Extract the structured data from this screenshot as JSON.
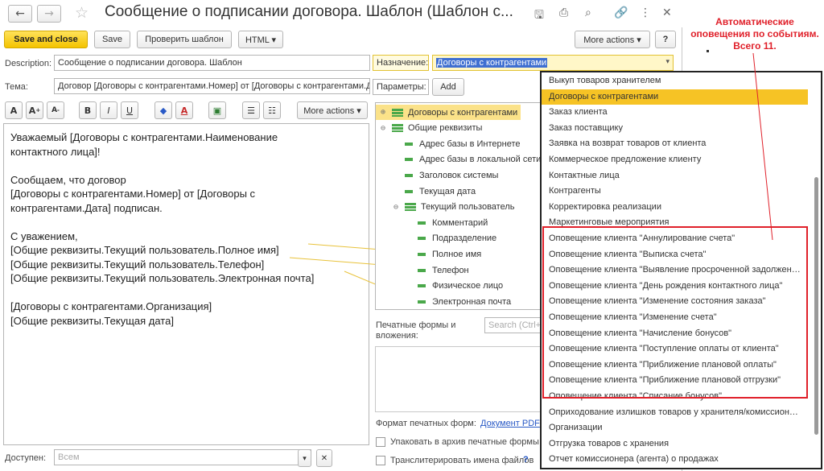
{
  "window": {
    "title": "Сообщение о подписании договора. Шаблон (Шаблон с...",
    "nav_back": "←",
    "nav_forward": "→",
    "favorite_icon": "star-icon",
    "title_icons": [
      "save-icon",
      "print-icon",
      "preview-icon",
      "link-icon",
      "more-icon",
      "close-icon"
    ]
  },
  "toolbar": {
    "save_and_close": "Save and close",
    "save": "Save",
    "check_template": "Проверить шаблон",
    "html": "HTML ▾",
    "more_actions": "More actions ▾",
    "help": "?"
  },
  "form": {
    "description_label": "Description:",
    "description_value": "Сообщение о подписании договора. Шаблон",
    "subject_label": "Тема:",
    "subject_value": "Договор [Договоры с контрагентами.Номер] от [Договоры с контрагентами.Д",
    "purpose_label": "Назначение:",
    "purpose_value": "Договоры с контрагентами",
    "params_label": "Параметры:",
    "add_button": "Add",
    "available_label": "Доступен:",
    "available_placeholder": "Всем"
  },
  "format_toolbar": {
    "buttons": [
      "A",
      "A⁺",
      "A⁻",
      "B",
      "I",
      "U",
      "◆",
      "A",
      "▣",
      "☰",
      "☷"
    ],
    "more_actions": "More actions ▾"
  },
  "editor": {
    "text": "Уважаемый [Договоры с контрагентами.Наименование\nконтактного лица]!\n\nСообщаем, что договор\n[Договоры с контрагентами.Номер] от [Договоры с\nконтрагентами.Дата] подписан.\n\nС уважением,\n[Общие реквизиты.Текущий пользователь.Полное имя]\n[Общие реквизиты.Текущий пользователь.Телефон]\n[Общие реквизиты.Текущий пользователь.Электронная почта]\n\n[Договоры с контрагентами.Организация]\n[Общие реквизиты.Текущая дата]"
  },
  "tree": {
    "items": [
      {
        "label": "Договоры с контрагентами",
        "level": 0,
        "kind": "collapsed",
        "selected": true
      },
      {
        "label": "Общие реквизиты",
        "level": 0,
        "kind": "expanded",
        "selected": false
      },
      {
        "label": "Адрес базы в Интернете",
        "level": 1,
        "kind": "leaf",
        "selected": false
      },
      {
        "label": "Адрес базы в локальной сети",
        "level": 1,
        "kind": "leaf",
        "selected": false
      },
      {
        "label": "Заголовок системы",
        "level": 1,
        "kind": "leaf",
        "selected": false
      },
      {
        "label": "Текущая дата",
        "level": 1,
        "kind": "leaf",
        "selected": false
      },
      {
        "label": "Текущий пользователь",
        "level": 1,
        "kind": "expanded",
        "selected": false
      },
      {
        "label": "Комментарий",
        "level": 2,
        "kind": "leaf",
        "selected": false
      },
      {
        "label": "Подразделение",
        "level": 2,
        "kind": "leaf",
        "selected": false
      },
      {
        "label": "Полное имя",
        "level": 2,
        "kind": "leaf",
        "selected": false
      },
      {
        "label": "Телефон",
        "level": 2,
        "kind": "leaf",
        "selected": false
      },
      {
        "label": "Физическое лицо",
        "level": 2,
        "kind": "leaf",
        "selected": false
      },
      {
        "label": "Электронная почта",
        "level": 2,
        "kind": "leaf",
        "selected": false
      }
    ]
  },
  "attachments": {
    "label_line1": "Печатные формы и",
    "label_line2": "вложения:",
    "search_placeholder": "Search (Ctrl+F)",
    "format_label": "Формат печатных форм:",
    "format_link": "Документ PDF",
    "zip_checkbox": "Упаковать в архив печатные формы",
    "translit_checkbox": "Транслитерировать имена файлов",
    "help": "?"
  },
  "dropdown": {
    "items": [
      "Выкуп товаров хранителем",
      "Договоры с контрагентами",
      "Заказ клиента",
      "Заказ поставщику",
      "Заявка на возврат товаров от клиента",
      "Коммерческое предложение клиенту",
      "Контактные лица",
      "Контрагенты",
      "Корректировка реализации",
      "Маркетинговые мероприятия",
      "Оповещение клиента \"Аннулирование счета\"",
      "Оповещение клиента \"Выписка счета\"",
      "Оповещение клиента \"Выявление просроченной задолженн...",
      "Оповещение клиента \"День рождения контактного лица\"",
      "Оповещение клиента \"Изменение состояния заказа\"",
      "Оповещение клиента \"Изменение счета\"",
      "Оповещение клиента \"Начисление бонусов\"",
      "Оповещение клиента \"Поступление оплаты от клиента\"",
      "Оповещение клиента \"Приближение плановой оплаты\"",
      "Оповещение клиента \"Приближение плановой отгрузки\"",
      "Оповещение клиента \"Списание бонусов\"",
      "Оприходование излишков товаров у хранителя/комиссионера",
      "Организации",
      "Отгрузка товаров с хранения",
      "Отчет комиссионера (агента) о продажах"
    ],
    "selected_index": 1
  },
  "annotation": {
    "line1": "Автоматические",
    "line2": "оповещения по событиям.",
    "line3": "Всего 11."
  },
  "colors": {
    "accent_yellow": "#f4c300",
    "selection_yellow": "#fbe289",
    "annotation_red": "#e0202a",
    "leaf_green": "#4aa84a",
    "link_blue": "#2859c6"
  }
}
